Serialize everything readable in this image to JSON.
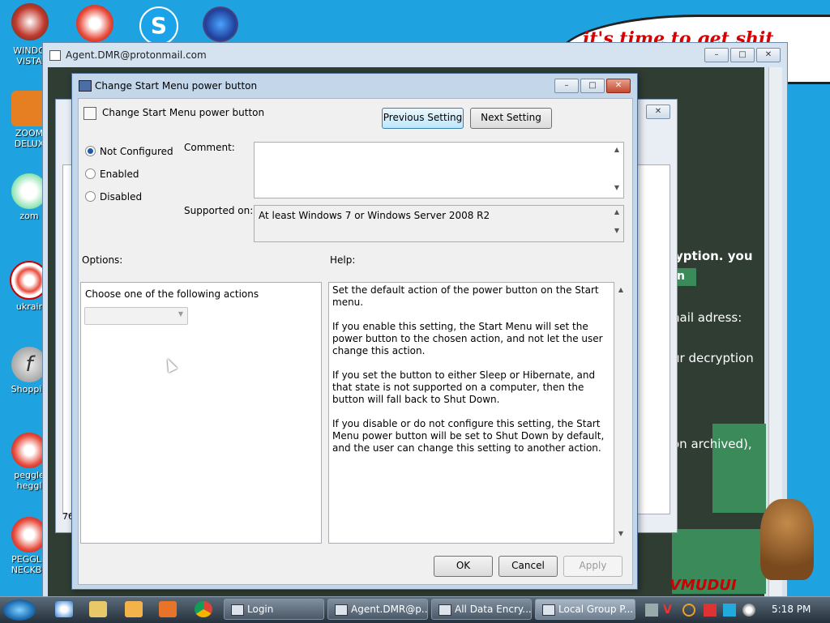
{
  "desktop": {
    "icons": [
      {
        "name": "windows-vista-icon",
        "label": "WINDO\nVISTA",
        "color": "#c0392b"
      },
      {
        "name": "zoom-deluxe-icon",
        "label": "ZOOM\nDELUX",
        "color": "#e67e22"
      },
      {
        "name": "zoma-icon",
        "label": "zom",
        "color": "#2ecc71"
      },
      {
        "name": "ukraine-icon",
        "label": "ukrair",
        "color": "#e74c3c"
      },
      {
        "name": "shopping-icon",
        "label": "Shoppin",
        "color": "#7f8c8d"
      },
      {
        "name": "peggle-heggle-icon",
        "label": "peggle\nheggl",
        "color": "#e74c3c"
      },
      {
        "name": "peggle-neckbeard-icon",
        "label": "PEGGLE\nNECKBE",
        "color": "#e74c3c"
      }
    ],
    "top_icons": [
      {
        "name": "peggle-top-icon",
        "color": "#e74c3c"
      },
      {
        "name": "skype-icon",
        "color": "#1aa3e8"
      },
      {
        "name": "firefox-icon",
        "color": "#2060c0"
      }
    ],
    "bubble_text": "it's time to get shit",
    "logo_text": "VMUDUI"
  },
  "bg_window": {
    "title": "Agent.DMR@protonmail.com",
    "lines": [
      "yption. you",
      "n",
      "nail adress:",
      "ur decryption",
      "on archived),"
    ]
  },
  "dialog": {
    "title": "Change Start Menu power button",
    "policy_name": "Change Start Menu power button",
    "prev_label": "Previous Setting",
    "next_label": "Next Setting",
    "radio": {
      "not_configured": "Not Configured",
      "enabled": "Enabled",
      "disabled": "Disabled",
      "selected": "Not Configured"
    },
    "comment_label": "Comment:",
    "comment_value": "",
    "supported_label": "Supported on:",
    "supported_value": "At least Windows 7 or Windows Server 2008 R2",
    "options_label": "Options:",
    "help_label": "Help:",
    "options_prompt": "Choose one of the following actions",
    "options_select_value": "",
    "help": [
      "Set the default action of the power button on the Start menu.",
      "If you enable this setting, the Start Menu will set the power button to the chosen action, and not let the user change this action.",
      "If you set the button to either Sleep or Hibernate, and that state is not supported on a computer, then the button will fall back to Shut Down.",
      "If you disable or do not configure this setting, the Start Menu power button will be set to Shut Down by default, and the user can change this setting to another action."
    ],
    "ok_label": "OK",
    "cancel_label": "Cancel",
    "apply_label": "Apply"
  },
  "mid_window": {
    "status_prefix": "76"
  },
  "taskbar": {
    "tasks": [
      {
        "name": "task-login",
        "label": "Login"
      },
      {
        "name": "task-agent-dmr",
        "label": "Agent.DMR@p..."
      },
      {
        "name": "task-all-data-encry",
        "label": "All Data Encry..."
      },
      {
        "name": "task-local-group-policy",
        "label": "Local Group P..."
      }
    ],
    "clock": "5:18 PM"
  }
}
